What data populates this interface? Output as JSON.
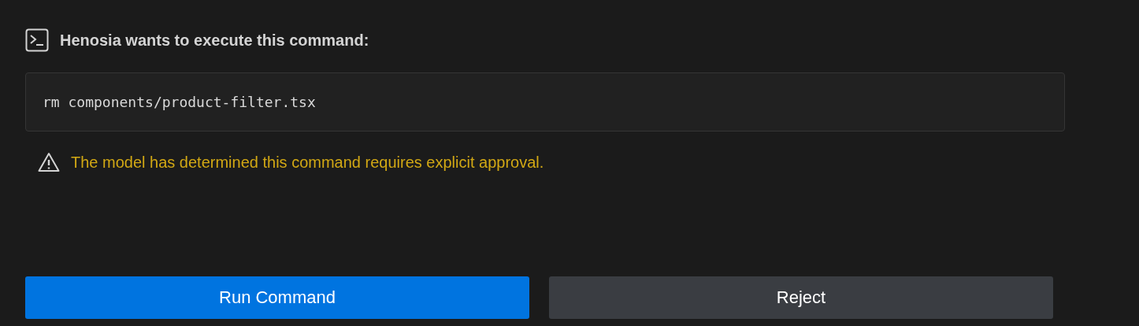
{
  "title": "Henosia wants to execute this command:",
  "command": "rm components/product-filter.tsx",
  "warning": "The model has determined this command requires explicit approval.",
  "buttons": [
    {
      "label": "Run Command",
      "kind": "primary"
    },
    {
      "label": "Reject",
      "kind": "secondary"
    }
  ]
}
